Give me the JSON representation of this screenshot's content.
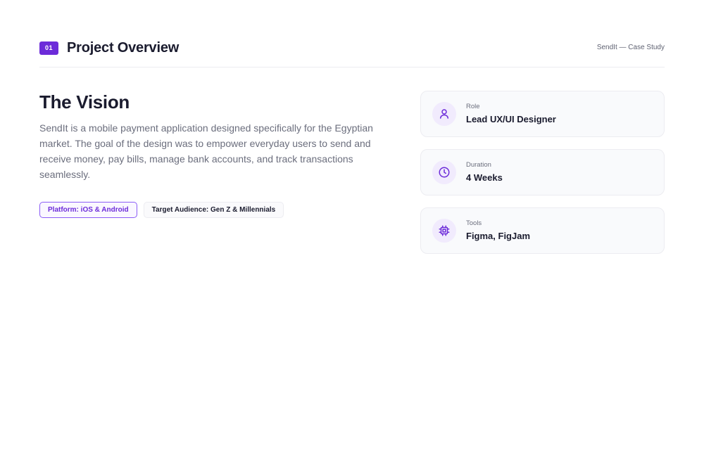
{
  "header": {
    "section_number": "01",
    "title": "Project Overview",
    "case_study": "SendIt — Case Study"
  },
  "vision": {
    "title": "The Vision",
    "description": "SendIt is a mobile payment application designed specifically for the Egyptian market. The goal of the design was to empower everyday users to send and receive money, pay bills, manage bank accounts, and track transactions seamlessly."
  },
  "tags": [
    {
      "label": "Platform: iOS & Android"
    },
    {
      "label": "Target Audience: Gen Z & Millennials"
    }
  ],
  "details": [
    {
      "label": "Role",
      "value": "Lead UX/UI Designer",
      "icon": "user-icon"
    },
    {
      "label": "Duration",
      "value": "4 Weeks",
      "icon": "clock-icon"
    },
    {
      "label": "Tools",
      "value": "Figma, FigJam",
      "icon": "cpu-chip-icon"
    }
  ],
  "colors": {
    "accent": "#6c2bd9",
    "accent_light": "#f1ebfd",
    "text_primary": "#1a1b2e",
    "text_muted": "#6b6e7d"
  }
}
